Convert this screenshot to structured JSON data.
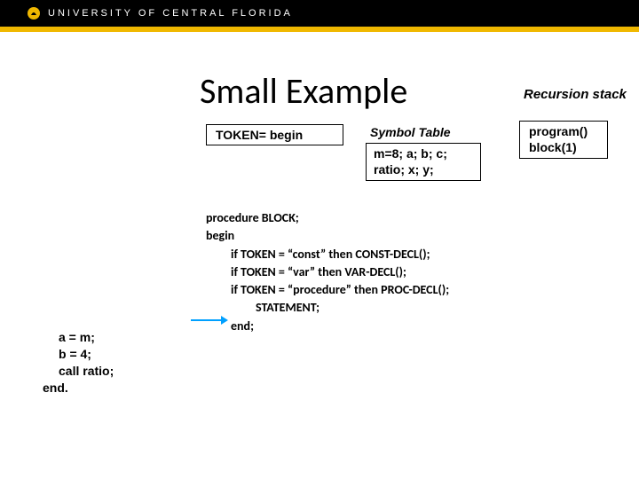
{
  "header": {
    "university": "UNIVERSITY OF CENTRAL FLORIDA"
  },
  "slide": {
    "title": "Small Example",
    "recursion_label": "Recursion stack",
    "token_box": "TOKEN= begin",
    "symbol_label": "Symbol Table",
    "symbol_box_line1": "m=8; a; b; c;",
    "symbol_box_line2": "ratio; x; y;",
    "stack_line1": "program()",
    "stack_line2": "block(1)",
    "proc": {
      "l1": "procedure BLOCK;",
      "l2": "begin",
      "l3": "if TOKEN = “const” then CONST-DECL();",
      "l4": "if TOKEN = “var” then VAR-DECL();",
      "l5": "if TOKEN = “procedure” then  PROC-DECL();",
      "l6": "STATEMENT;",
      "l7": "end;"
    },
    "left_code": {
      "c1": "a = m;",
      "c2": "b = 4;",
      "c3": "call ratio;",
      "c4": "end."
    }
  }
}
